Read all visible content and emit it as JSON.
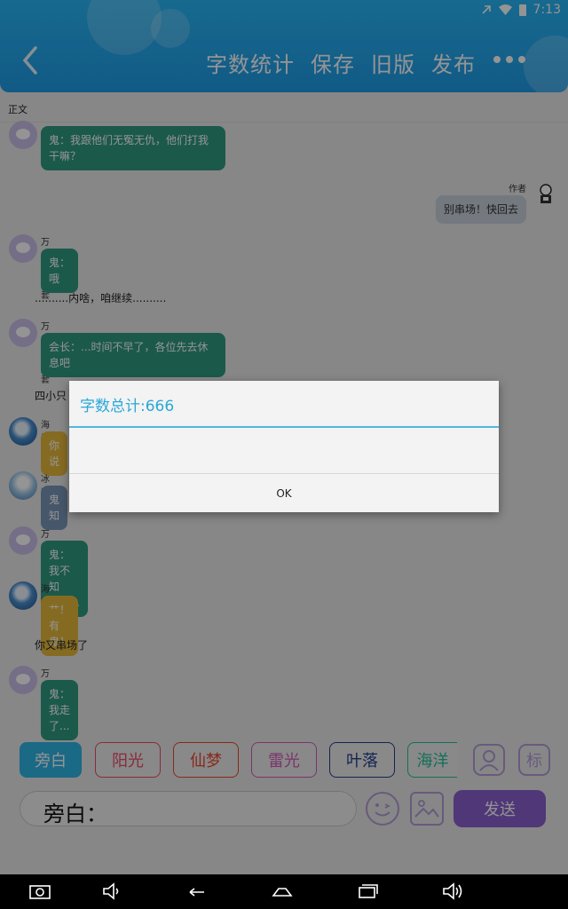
{
  "status_bar": {
    "time": "7:13"
  },
  "header": {
    "actions": [
      "字数统计",
      "保存",
      "旧版",
      "发布"
    ]
  },
  "section_label": "正文",
  "messages": [
    {
      "type": "left",
      "avatar": "purple",
      "sender": "",
      "text": "鬼：我跟他们无冤无仇，他们打我干嘛？",
      "bubble": "green"
    },
    {
      "type": "right",
      "sender": "作者",
      "text": "别串场！快回去"
    },
    {
      "type": "left",
      "avatar": "purple",
      "sender": "万能跑龙套",
      "text": "鬼：哦",
      "bubble": "green"
    },
    {
      "type": "narration",
      "text": "..........内啥，咱继续.........."
    },
    {
      "type": "left",
      "avatar": "purple",
      "sender": "万能跑龙套",
      "text": "会长：...时间不早了，各位先去休息吧",
      "bubble": "green"
    },
    {
      "type": "narration",
      "text": "四小只"
    },
    {
      "type": "left",
      "avatar": "ocean",
      "sender": "海洋",
      "text": "你说",
      "bubble": "yellow"
    },
    {
      "type": "left",
      "avatar": "ice",
      "sender": "冰凌",
      "text": "鬼知",
      "bubble": "blue"
    },
    {
      "type": "left",
      "avatar": "purple",
      "sender": "万能跑龙套",
      "text": "鬼：我不知道......",
      "bubble": "green"
    },
    {
      "type": "left",
      "avatar": "ocean",
      "sender": "海洋",
      "text": "艹！有鬼！",
      "bubble": "yellow"
    },
    {
      "type": "narration",
      "text": "你又串场了"
    },
    {
      "type": "left",
      "avatar": "purple",
      "sender": "万能跑龙套",
      "text": "鬼：我走了...",
      "bubble": "green"
    }
  ],
  "dialog": {
    "title": "字数总计:666",
    "ok_label": "OK"
  },
  "roles": [
    {
      "label": "旁白",
      "color": "#2db6e6",
      "active": true
    },
    {
      "label": "阳光",
      "color": "#e84a6a",
      "active": false
    },
    {
      "label": "仙梦",
      "color": "#e8472f",
      "active": false
    },
    {
      "label": "雷光",
      "color": "#d45ab8",
      "active": false
    },
    {
      "label": "叶落",
      "color": "#1f3f8a",
      "active": false
    },
    {
      "label": "海洋",
      "color": "#1fbf9a",
      "active": false
    }
  ],
  "tag_button_label": "标",
  "input": {
    "prefix": "旁白：",
    "value": ""
  },
  "send_label": "发送",
  "colors": {
    "header": "#1e9ce8",
    "accent": "#29a8d8",
    "send": "#8b5fcf"
  }
}
